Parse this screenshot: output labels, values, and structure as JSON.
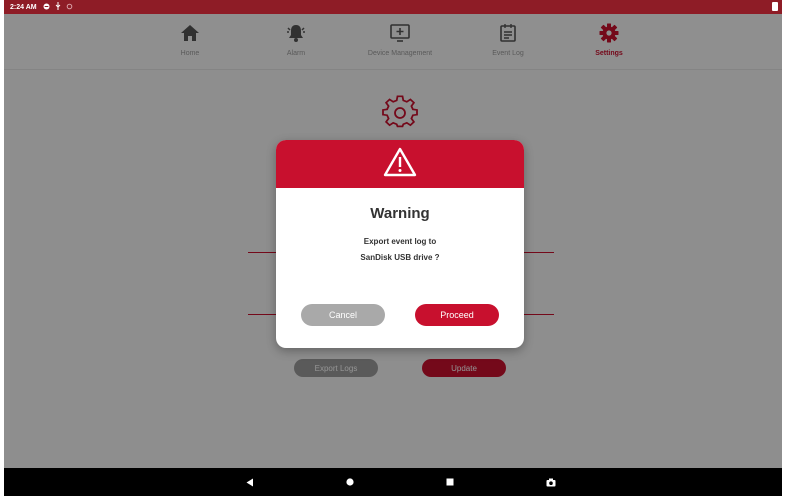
{
  "status_bar": {
    "time": "2:24 AM"
  },
  "tabs": [
    {
      "label": "Home"
    },
    {
      "label": "Alarm"
    },
    {
      "label": "Device Management"
    },
    {
      "label": "Event Log"
    },
    {
      "label": "Settings"
    }
  ],
  "settings": {
    "export_logs_label": "Export Logs",
    "update_label": "Update"
  },
  "dialog": {
    "title": "Warning",
    "message_line1": "Export event log to",
    "message_line2": "SanDisk USB drive ?",
    "cancel_label": "Cancel",
    "proceed_label": "Proceed"
  },
  "colors": {
    "accent": "#c8102e",
    "status_bar": "#8e1c26",
    "cancel": "#a9a9a9"
  }
}
